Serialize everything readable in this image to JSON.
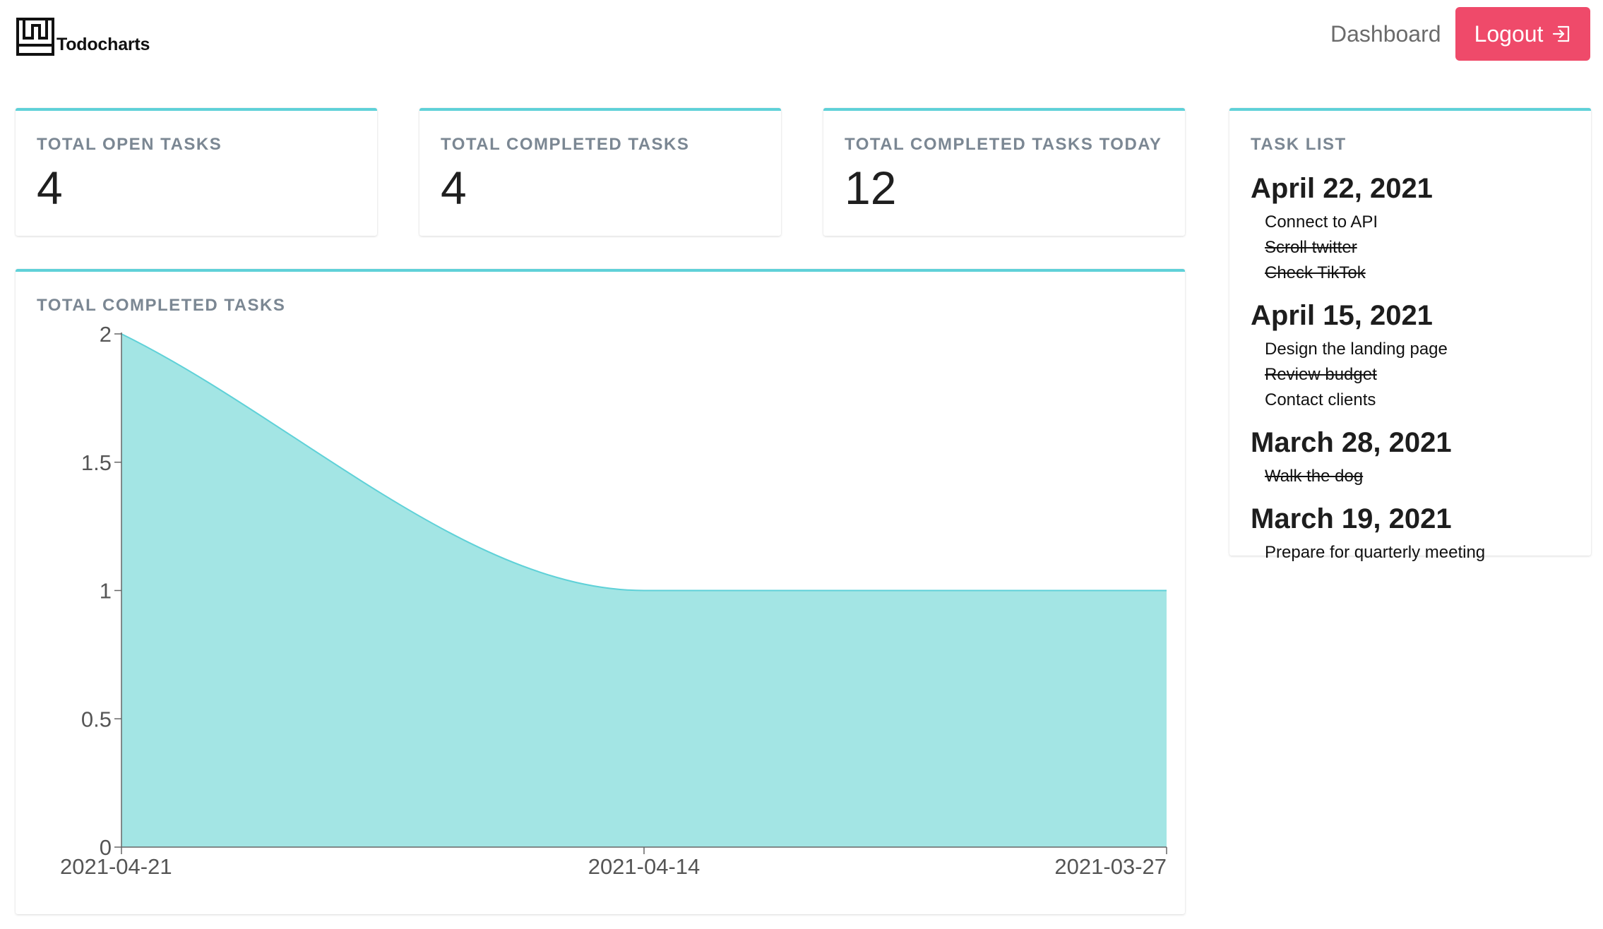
{
  "app": {
    "name": "Todocharts"
  },
  "nav": {
    "dashboard_label": "Dashboard",
    "logout_label": "Logout"
  },
  "colors": {
    "accent": "#5fd1d8",
    "area_fill": "#a3e5e4",
    "logout_bg": "#ef4a6a",
    "label_gray": "#7b8793"
  },
  "stats": [
    {
      "label": "TOTAL OPEN TASKS",
      "value": "4"
    },
    {
      "label": "TOTAL COMPLETED TASKS",
      "value": "4"
    },
    {
      "label": "TOTAL COMPLETED TASKS TODAY",
      "value": "12"
    }
  ],
  "chart_card": {
    "label": "TOTAL COMPLETED TASKS"
  },
  "chart_data": {
    "type": "area",
    "x": [
      "2021-04-21",
      "2021-04-14",
      "2021-03-27"
    ],
    "values": [
      2,
      1,
      1
    ],
    "ylim": [
      0,
      2
    ],
    "yticks": [
      {
        "value": 0,
        "label": "0"
      },
      {
        "value": 0.5,
        "label": "0.5"
      },
      {
        "value": 1,
        "label": "1"
      },
      {
        "value": 1.5,
        "label": "1.5"
      },
      {
        "value": 2,
        "label": "2"
      }
    ],
    "title": "",
    "xlabel": "",
    "ylabel": "",
    "grid": false,
    "curve": "monotone"
  },
  "task_list": {
    "label": "TASK LIST",
    "groups": [
      {
        "date": "April 22, 2021",
        "tasks": [
          {
            "text": "Connect to API",
            "done": false
          },
          {
            "text": "Scroll twitter",
            "done": true
          },
          {
            "text": "Check TikTok",
            "done": true
          }
        ]
      },
      {
        "date": "April 15, 2021",
        "tasks": [
          {
            "text": "Design the landing page",
            "done": false
          },
          {
            "text": "Review budget",
            "done": true
          },
          {
            "text": "Contact clients",
            "done": false
          }
        ]
      },
      {
        "date": "March 28, 2021",
        "tasks": [
          {
            "text": "Walk the dog",
            "done": true
          }
        ]
      },
      {
        "date": "March 19, 2021",
        "tasks": [
          {
            "text": "Prepare for quarterly meeting",
            "done": false
          }
        ]
      }
    ]
  }
}
